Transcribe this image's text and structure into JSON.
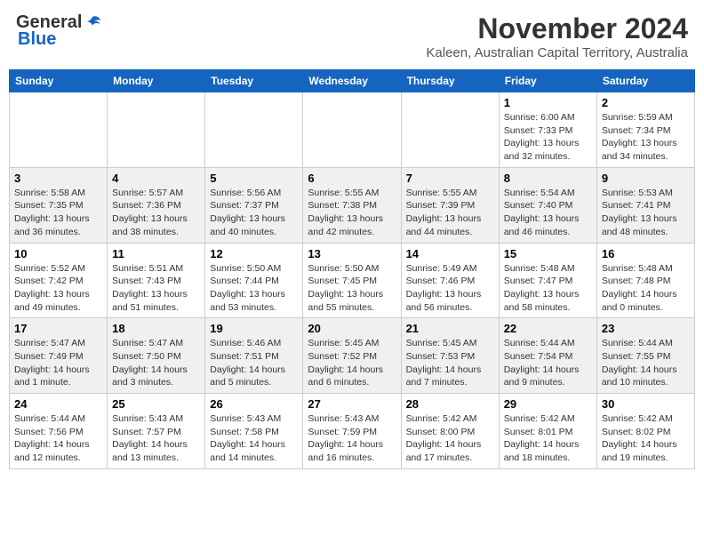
{
  "header": {
    "logo_general": "General",
    "logo_blue": "Blue",
    "title": "November 2024",
    "location": "Kaleen, Australian Capital Territory, Australia"
  },
  "weekdays": [
    "Sunday",
    "Monday",
    "Tuesday",
    "Wednesday",
    "Thursday",
    "Friday",
    "Saturday"
  ],
  "weeks": [
    [
      {
        "day": "",
        "info": ""
      },
      {
        "day": "",
        "info": ""
      },
      {
        "day": "",
        "info": ""
      },
      {
        "day": "",
        "info": ""
      },
      {
        "day": "",
        "info": ""
      },
      {
        "day": "1",
        "info": "Sunrise: 6:00 AM\nSunset: 7:33 PM\nDaylight: 13 hours\nand 32 minutes."
      },
      {
        "day": "2",
        "info": "Sunrise: 5:59 AM\nSunset: 7:34 PM\nDaylight: 13 hours\nand 34 minutes."
      }
    ],
    [
      {
        "day": "3",
        "info": "Sunrise: 5:58 AM\nSunset: 7:35 PM\nDaylight: 13 hours\nand 36 minutes."
      },
      {
        "day": "4",
        "info": "Sunrise: 5:57 AM\nSunset: 7:36 PM\nDaylight: 13 hours\nand 38 minutes."
      },
      {
        "day": "5",
        "info": "Sunrise: 5:56 AM\nSunset: 7:37 PM\nDaylight: 13 hours\nand 40 minutes."
      },
      {
        "day": "6",
        "info": "Sunrise: 5:55 AM\nSunset: 7:38 PM\nDaylight: 13 hours\nand 42 minutes."
      },
      {
        "day": "7",
        "info": "Sunrise: 5:55 AM\nSunset: 7:39 PM\nDaylight: 13 hours\nand 44 minutes."
      },
      {
        "day": "8",
        "info": "Sunrise: 5:54 AM\nSunset: 7:40 PM\nDaylight: 13 hours\nand 46 minutes."
      },
      {
        "day": "9",
        "info": "Sunrise: 5:53 AM\nSunset: 7:41 PM\nDaylight: 13 hours\nand 48 minutes."
      }
    ],
    [
      {
        "day": "10",
        "info": "Sunrise: 5:52 AM\nSunset: 7:42 PM\nDaylight: 13 hours\nand 49 minutes."
      },
      {
        "day": "11",
        "info": "Sunrise: 5:51 AM\nSunset: 7:43 PM\nDaylight: 13 hours\nand 51 minutes."
      },
      {
        "day": "12",
        "info": "Sunrise: 5:50 AM\nSunset: 7:44 PM\nDaylight: 13 hours\nand 53 minutes."
      },
      {
        "day": "13",
        "info": "Sunrise: 5:50 AM\nSunset: 7:45 PM\nDaylight: 13 hours\nand 55 minutes."
      },
      {
        "day": "14",
        "info": "Sunrise: 5:49 AM\nSunset: 7:46 PM\nDaylight: 13 hours\nand 56 minutes."
      },
      {
        "day": "15",
        "info": "Sunrise: 5:48 AM\nSunset: 7:47 PM\nDaylight: 13 hours\nand 58 minutes."
      },
      {
        "day": "16",
        "info": "Sunrise: 5:48 AM\nSunset: 7:48 PM\nDaylight: 14 hours\nand 0 minutes."
      }
    ],
    [
      {
        "day": "17",
        "info": "Sunrise: 5:47 AM\nSunset: 7:49 PM\nDaylight: 14 hours\nand 1 minute."
      },
      {
        "day": "18",
        "info": "Sunrise: 5:47 AM\nSunset: 7:50 PM\nDaylight: 14 hours\nand 3 minutes."
      },
      {
        "day": "19",
        "info": "Sunrise: 5:46 AM\nSunset: 7:51 PM\nDaylight: 14 hours\nand 5 minutes."
      },
      {
        "day": "20",
        "info": "Sunrise: 5:45 AM\nSunset: 7:52 PM\nDaylight: 14 hours\nand 6 minutes."
      },
      {
        "day": "21",
        "info": "Sunrise: 5:45 AM\nSunset: 7:53 PM\nDaylight: 14 hours\nand 7 minutes."
      },
      {
        "day": "22",
        "info": "Sunrise: 5:44 AM\nSunset: 7:54 PM\nDaylight: 14 hours\nand 9 minutes."
      },
      {
        "day": "23",
        "info": "Sunrise: 5:44 AM\nSunset: 7:55 PM\nDaylight: 14 hours\nand 10 minutes."
      }
    ],
    [
      {
        "day": "24",
        "info": "Sunrise: 5:44 AM\nSunset: 7:56 PM\nDaylight: 14 hours\nand 12 minutes."
      },
      {
        "day": "25",
        "info": "Sunrise: 5:43 AM\nSunset: 7:57 PM\nDaylight: 14 hours\nand 13 minutes."
      },
      {
        "day": "26",
        "info": "Sunrise: 5:43 AM\nSunset: 7:58 PM\nDaylight: 14 hours\nand 14 minutes."
      },
      {
        "day": "27",
        "info": "Sunrise: 5:43 AM\nSunset: 7:59 PM\nDaylight: 14 hours\nand 16 minutes."
      },
      {
        "day": "28",
        "info": "Sunrise: 5:42 AM\nSunset: 8:00 PM\nDaylight: 14 hours\nand 17 minutes."
      },
      {
        "day": "29",
        "info": "Sunrise: 5:42 AM\nSunset: 8:01 PM\nDaylight: 14 hours\nand 18 minutes."
      },
      {
        "day": "30",
        "info": "Sunrise: 5:42 AM\nSunset: 8:02 PM\nDaylight: 14 hours\nand 19 minutes."
      }
    ]
  ]
}
